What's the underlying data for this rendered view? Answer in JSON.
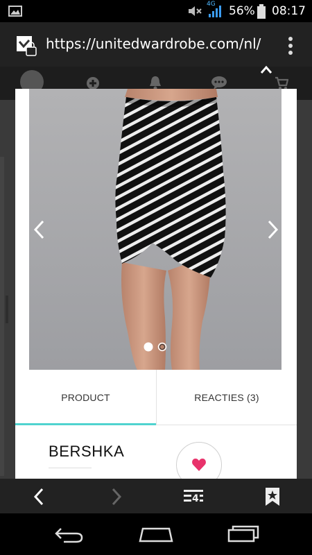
{
  "status_bar": {
    "network": "4G",
    "battery_percent": "56%",
    "time": "08:17"
  },
  "browser": {
    "url": "https://unitedwardrobe.com/nl/"
  },
  "carousel": {
    "slide_count": 2,
    "active_slide": 1
  },
  "tabs": [
    {
      "label": "PRODUCT",
      "active": true
    },
    {
      "label": "REACTIES (3)",
      "active": false
    }
  ],
  "product": {
    "brand": "BERSHKA"
  },
  "colors": {
    "accent": "#4fd3cf",
    "heart": "#e8326b"
  }
}
